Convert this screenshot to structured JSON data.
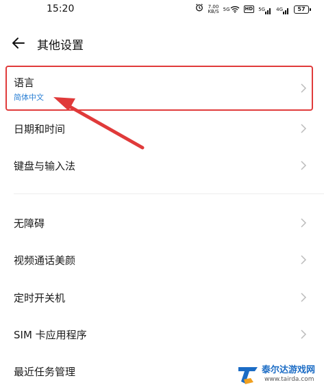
{
  "status_bar": {
    "time": "15:20",
    "speed_value": "7.00",
    "speed_unit": "KB/S",
    "network_1": "5G",
    "hd": "HD",
    "network_2": "5G",
    "network_3": "4G",
    "battery": "57"
  },
  "header": {
    "title": "其他设置"
  },
  "settings": {
    "language": {
      "label": "语言",
      "value": "简体中文"
    },
    "datetime": {
      "label": "日期和时间"
    },
    "keyboard": {
      "label": "键盘与输入法"
    },
    "accessibility": {
      "label": "无障碍"
    },
    "video_beauty": {
      "label": "视频通话美颜"
    },
    "scheduled_power": {
      "label": "定时开关机"
    },
    "sim_apps": {
      "label": "SIM 卡应用程序"
    },
    "recent_tasks": {
      "label": "最近任务管理"
    }
  },
  "colors": {
    "accent": "#2a7fd4",
    "annotation": "#e03a3a"
  },
  "watermark": {
    "name": "泰尔达游戏网",
    "url": "www.tairda.com"
  }
}
